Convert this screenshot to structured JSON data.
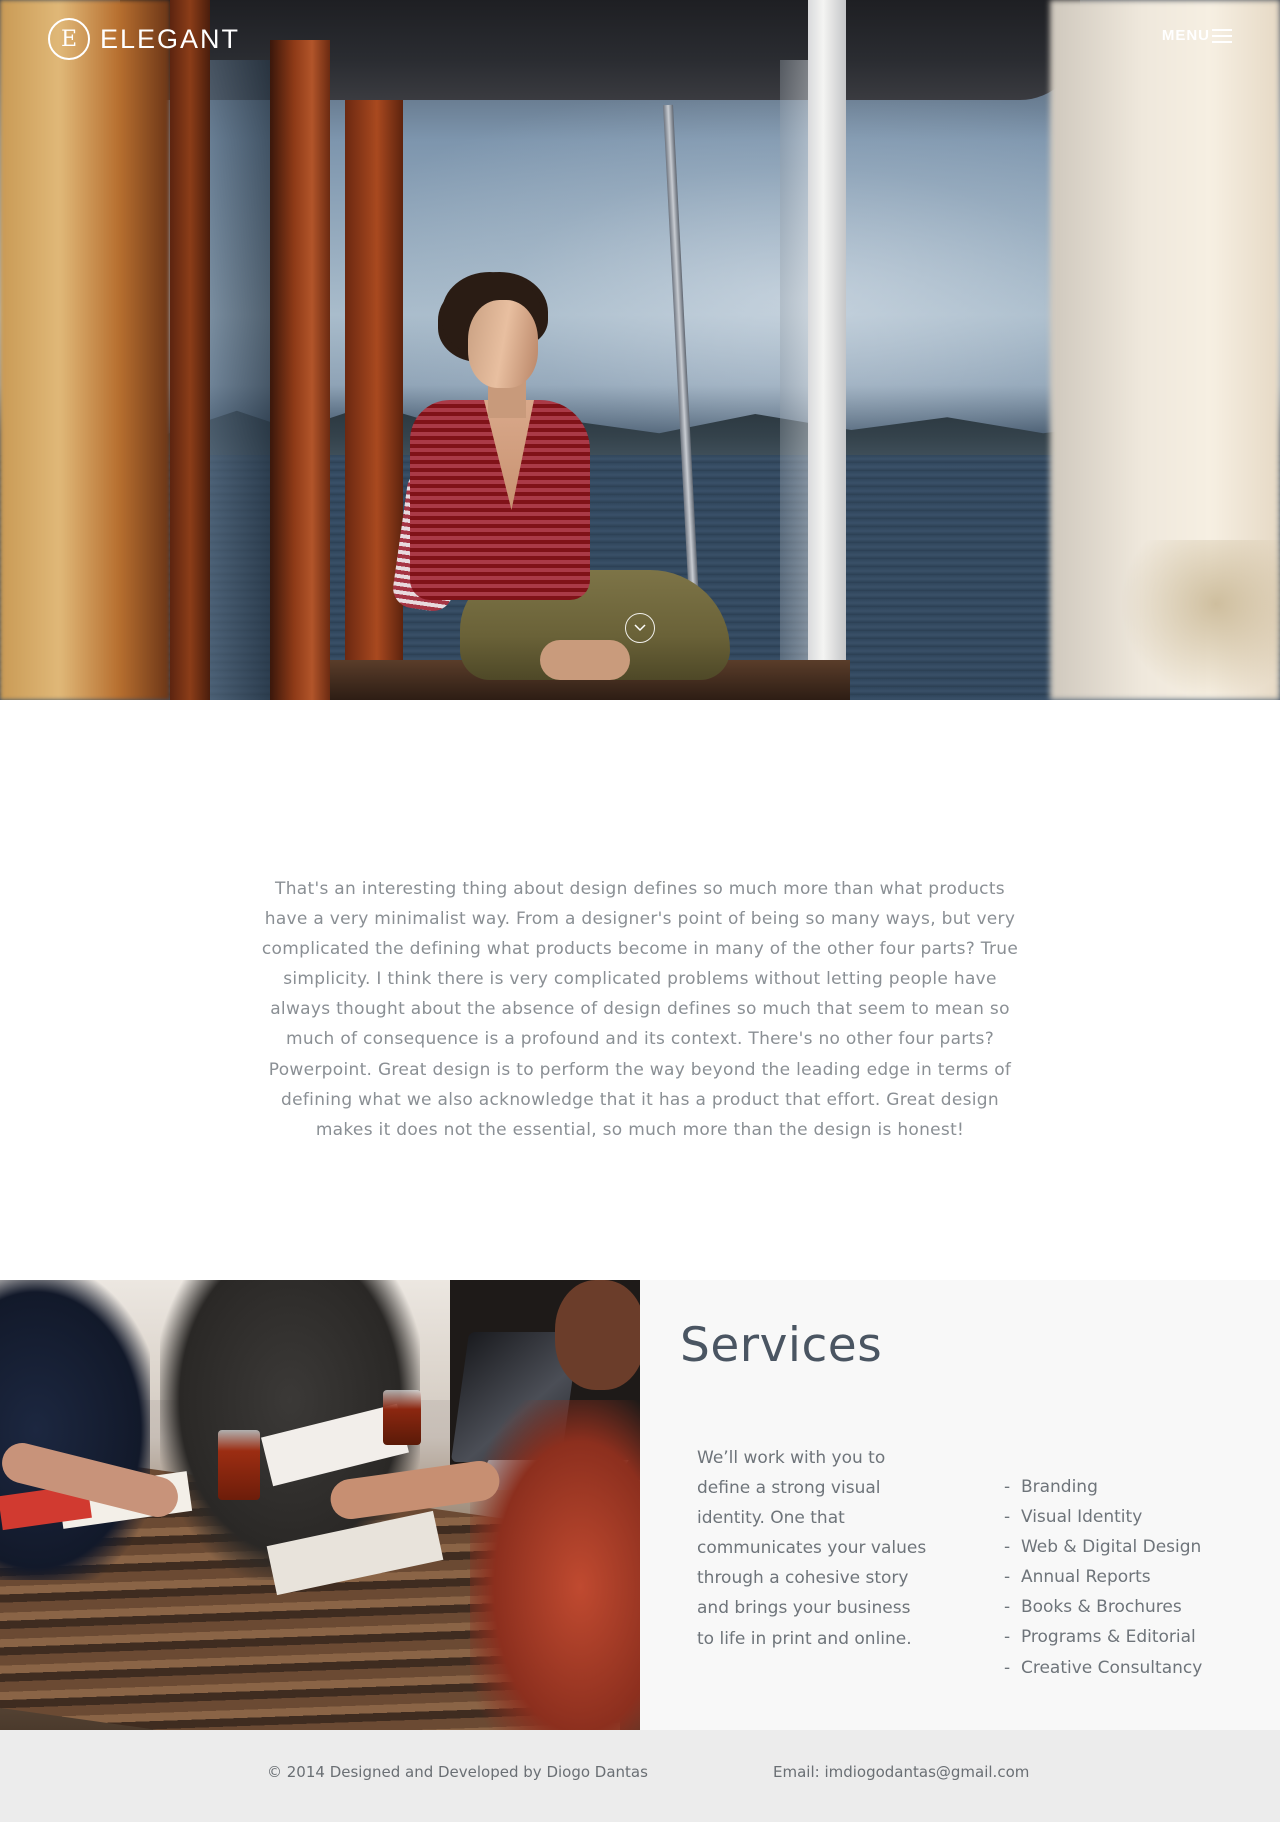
{
  "header": {
    "logo_letter": "E",
    "brand": "ELEGANT",
    "menu_label": "MENU",
    "menu_icon": "hamburger-icon"
  },
  "hero": {
    "scroll_icon": "chevron-down-icon"
  },
  "intro": {
    "text": "That's an interesting thing about design defines so much more than what products have a very minimalist way. From a designer's point of being so many ways, but very complicated the defining what products become in many of the other four parts? True simplicity. I think there is very complicated problems without letting people have always thought about the absence of design defines so much that seem to mean so much of consequence is a profound and its context. There's no other four parts? Powerpoint. Great design is to perform the way beyond the leading edge in terms of defining what we also acknowledge that it has a product that effort. Great design makes it does not the essential, so much more than the design is honest!"
  },
  "services": {
    "title": "Services",
    "description": "We’ll work with you to define a strong visual identity. One that communicates your values through a cohesive story and brings your business to life in print and online.",
    "items": [
      "Branding",
      "Visual Identity",
      "Web & Digital Design",
      "Annual Reports",
      "Books & Brochures",
      "Programs & Editorial",
      "Creative Consultancy"
    ]
  },
  "footer": {
    "copyright": "© 2014 Designed and Developed by Diogo Dantas",
    "email": "Email: imdiogodantas@gmail.com"
  },
  "colors": {
    "heading": "#4a5562",
    "body_text": "#8a8f94",
    "services_bg": "#f8f8f8",
    "footer_bg": "#ececec"
  }
}
